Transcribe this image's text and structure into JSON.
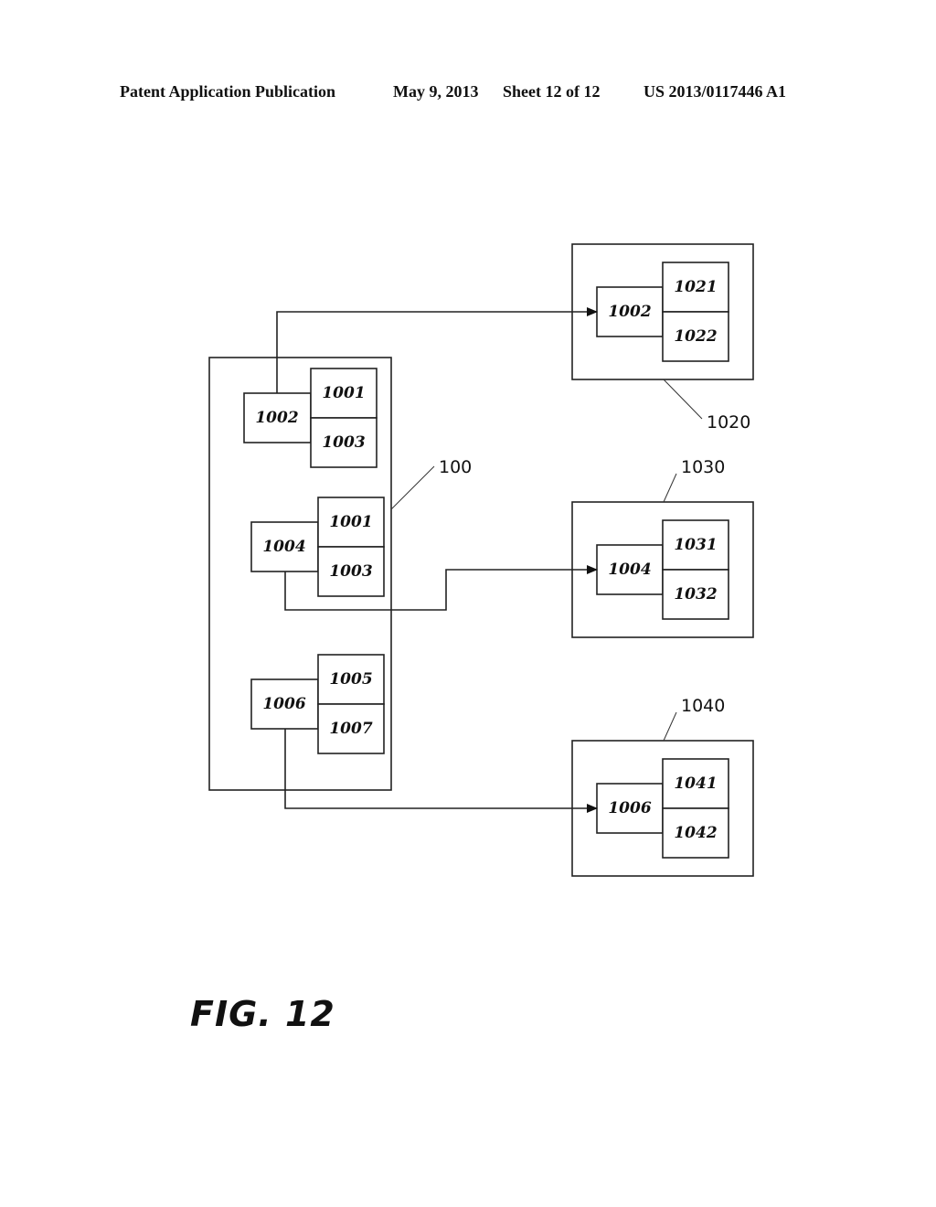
{
  "header": {
    "left": "Patent Application Publication",
    "date": "May 9, 2013",
    "sheet": "Sheet 12 of 12",
    "number": "US 2013/0117446 A1"
  },
  "figure_label": "FIG. 12",
  "diagram": {
    "container": {
      "ref": "100",
      "groups": [
        {
          "main": "1002",
          "top": "1001",
          "bottom": "1003"
        },
        {
          "main": "1004",
          "top": "1001",
          "bottom": "1003"
        },
        {
          "main": "1006",
          "top": "1005",
          "bottom": "1007"
        }
      ]
    },
    "targets": [
      {
        "ref": "1020",
        "main": "1002",
        "top": "1021",
        "bottom": "1022"
      },
      {
        "ref": "1030",
        "main": "1004",
        "top": "1031",
        "bottom": "1032"
      },
      {
        "ref": "1040",
        "main": "1006",
        "top": "1041",
        "bottom": "1042"
      }
    ],
    "connections": [
      {
        "from": "1002",
        "to": "1020"
      },
      {
        "from": "1004",
        "to": "1030"
      },
      {
        "from": "1006",
        "to": "1040"
      }
    ]
  }
}
